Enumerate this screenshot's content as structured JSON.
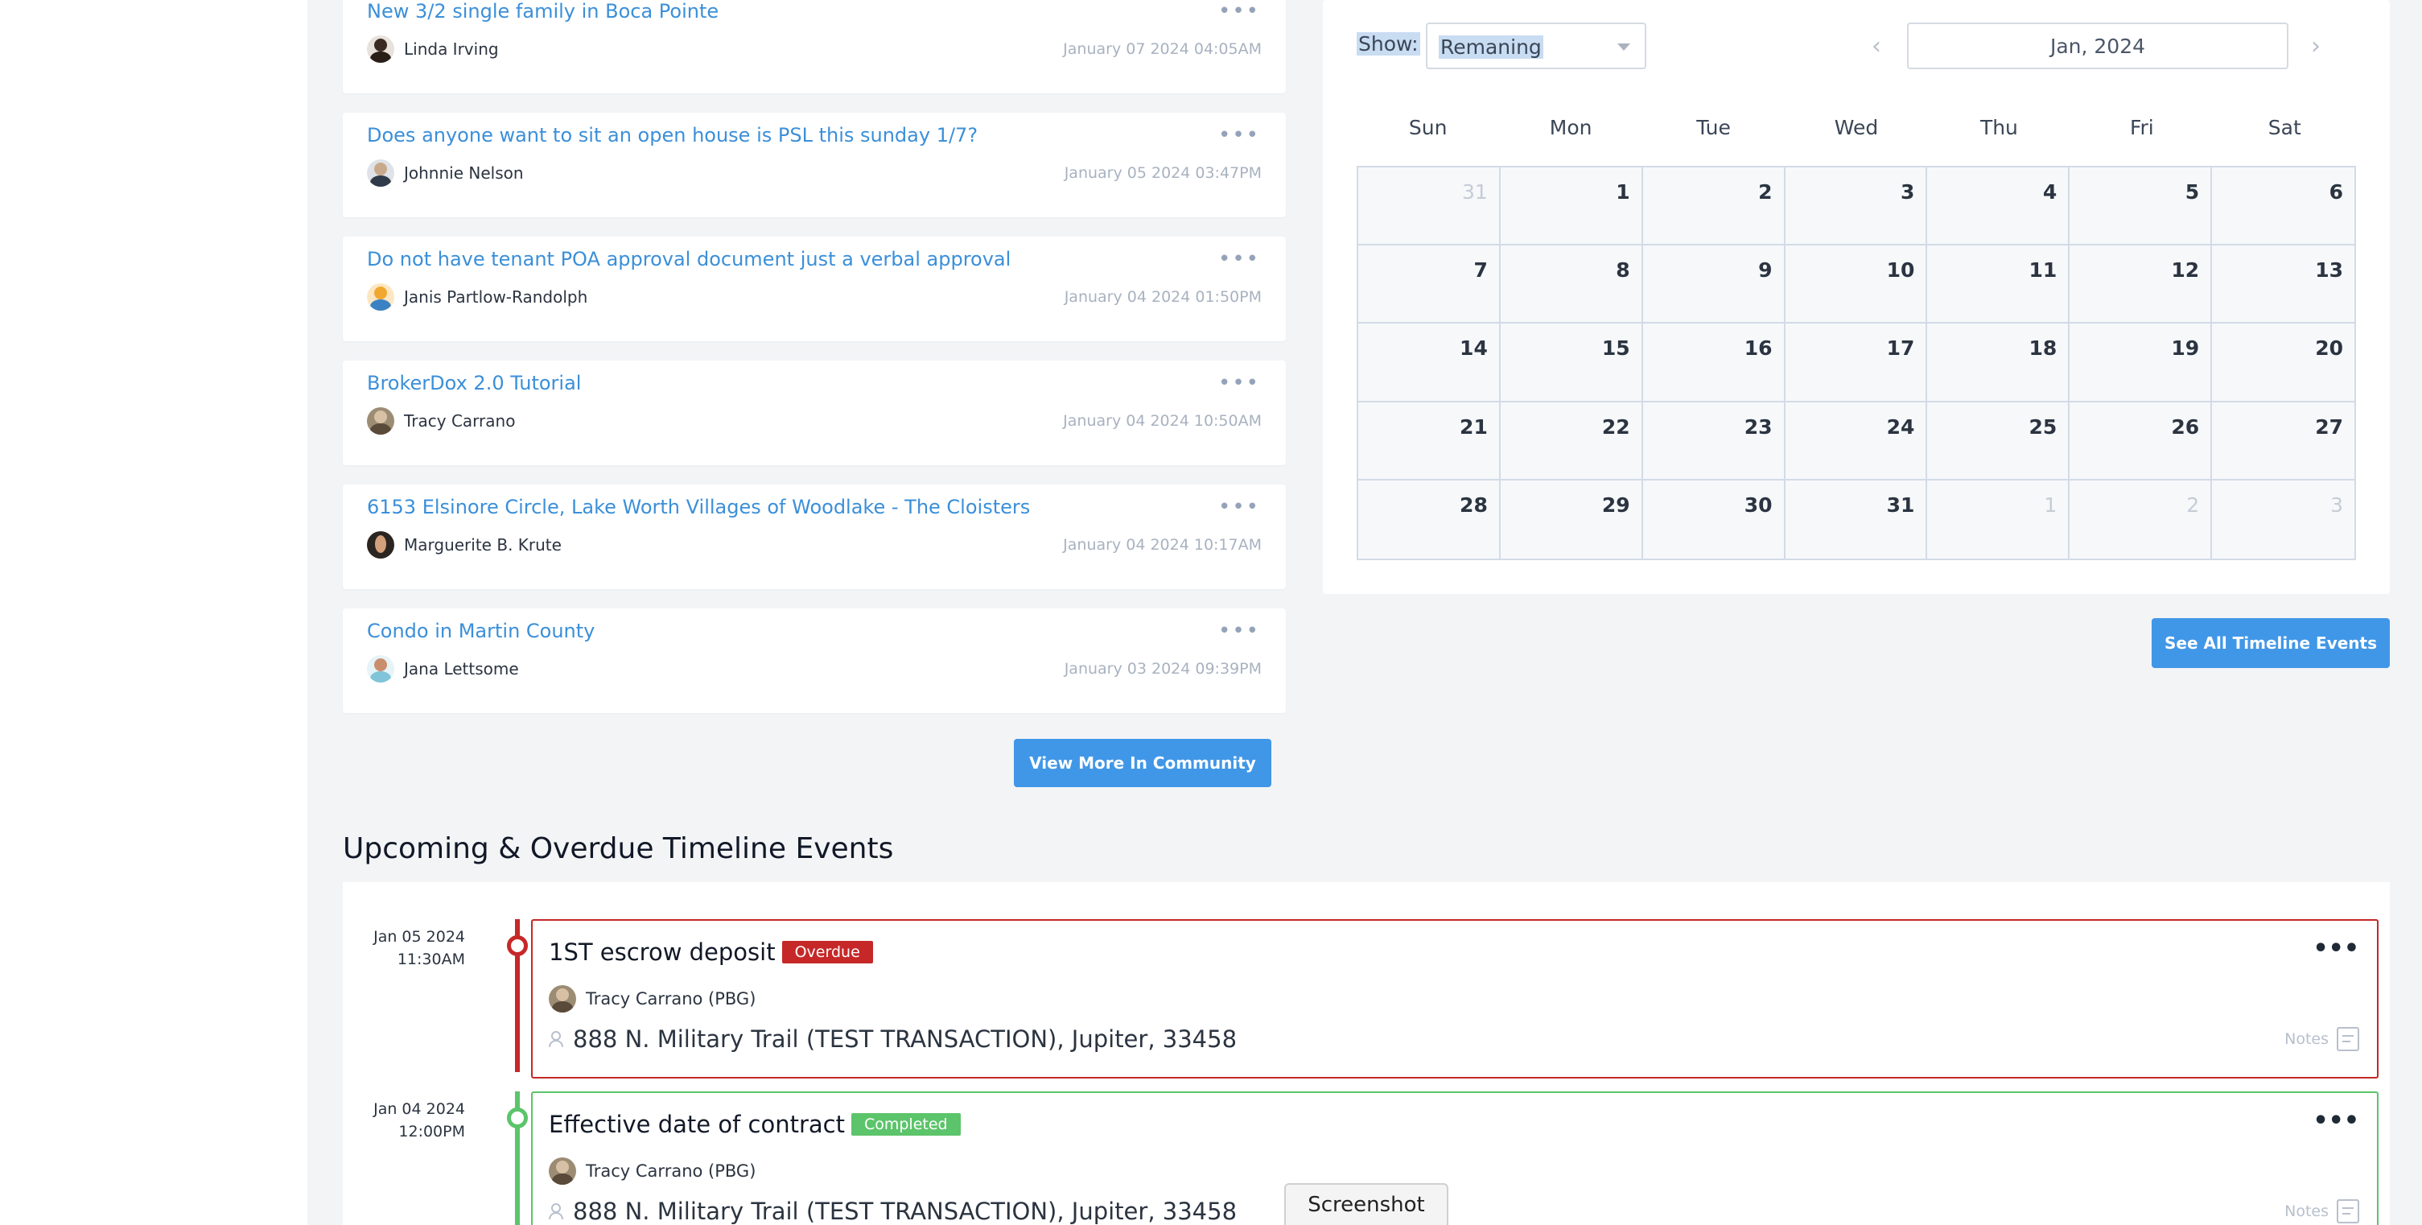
{
  "community": {
    "posts": [
      {
        "title": "New 3/2 single family in Boca Pointe",
        "author": "Linda Irving",
        "time": "January 07 2024 04:05AM",
        "avatar_color": "#3a2a22"
      },
      {
        "title": "Does anyone want to sit an open house is PSL this sunday 1/7?",
        "author": "Johnnie Nelson",
        "time": "January 05 2024 03:47PM",
        "avatar_color": "#2f3a4a"
      },
      {
        "title": "Do not have tenant POA approval document just a verbal approval",
        "author": "Janis Partlow-Randolph",
        "time": "January 04 2024 01:50PM",
        "avatar_color": "#f0a830"
      },
      {
        "title": "BrokerDox 2.0 Tutorial",
        "author": "Tracy Carrano",
        "time": "January 04 2024 10:50AM",
        "avatar_color": "#7a6a55"
      },
      {
        "title": "6153 Elsinore Circle, Lake Worth Villages of Woodlake - The Cloisters",
        "author": "Marguerite B. Krute",
        "time": "January 04 2024 10:17AM",
        "avatar_color": "#2a2520"
      },
      {
        "title": "Condo in Martin County",
        "author": "Jana Lettsome",
        "time": "January 03 2024 09:39PM",
        "avatar_color": "#7fc4d8"
      }
    ],
    "menu_icon": "ellipsis-icon",
    "view_more_label": "View More In Community"
  },
  "calendar": {
    "show_label": "Show:",
    "show_value": "Remaning",
    "month_label": "Jan, 2024",
    "prev_icon": "chevron-left-icon",
    "next_icon": "chevron-right-icon",
    "weekdays": [
      "Sun",
      "Mon",
      "Tue",
      "Wed",
      "Thu",
      "Fri",
      "Sat"
    ],
    "days": [
      {
        "n": "31",
        "muted": true
      },
      {
        "n": "1"
      },
      {
        "n": "2"
      },
      {
        "n": "3"
      },
      {
        "n": "4"
      },
      {
        "n": "5"
      },
      {
        "n": "6"
      },
      {
        "n": "7"
      },
      {
        "n": "8"
      },
      {
        "n": "9"
      },
      {
        "n": "10"
      },
      {
        "n": "11"
      },
      {
        "n": "12"
      },
      {
        "n": "13"
      },
      {
        "n": "14"
      },
      {
        "n": "15"
      },
      {
        "n": "16"
      },
      {
        "n": "17"
      },
      {
        "n": "18"
      },
      {
        "n": "19"
      },
      {
        "n": "20"
      },
      {
        "n": "21"
      },
      {
        "n": "22"
      },
      {
        "n": "23"
      },
      {
        "n": "24"
      },
      {
        "n": "25"
      },
      {
        "n": "26"
      },
      {
        "n": "27"
      },
      {
        "n": "28"
      },
      {
        "n": "29"
      },
      {
        "n": "30"
      },
      {
        "n": "31"
      },
      {
        "n": "1",
        "muted": true
      },
      {
        "n": "2",
        "muted": true
      },
      {
        "n": "3",
        "muted": true
      }
    ],
    "see_all_label": "See All Timeline Events"
  },
  "timeline": {
    "heading": "Upcoming & Overdue Timeline Events",
    "events": [
      {
        "date": "Jan 05 2024",
        "time": "11:30AM",
        "title": "1ST escrow deposit",
        "badge": "Overdue",
        "status_color": "#c62828",
        "agent": "Tracy Carrano (PBG)",
        "address": "888 N. Military Trail (TEST TRANSACTION), Jupiter, 33458",
        "notes_label": "Notes"
      },
      {
        "date": "Jan 04 2024",
        "time": "12:00PM",
        "title": "Effective date of contract",
        "badge": "Completed",
        "status_color": "#5cc46a",
        "agent": "Tracy Carrano (PBG)",
        "address": "888 N. Military Trail (TEST TRANSACTION), Jupiter, 33458",
        "notes_label": "Notes"
      }
    ]
  },
  "screenshot_tab": {
    "label": "Screenshot"
  }
}
